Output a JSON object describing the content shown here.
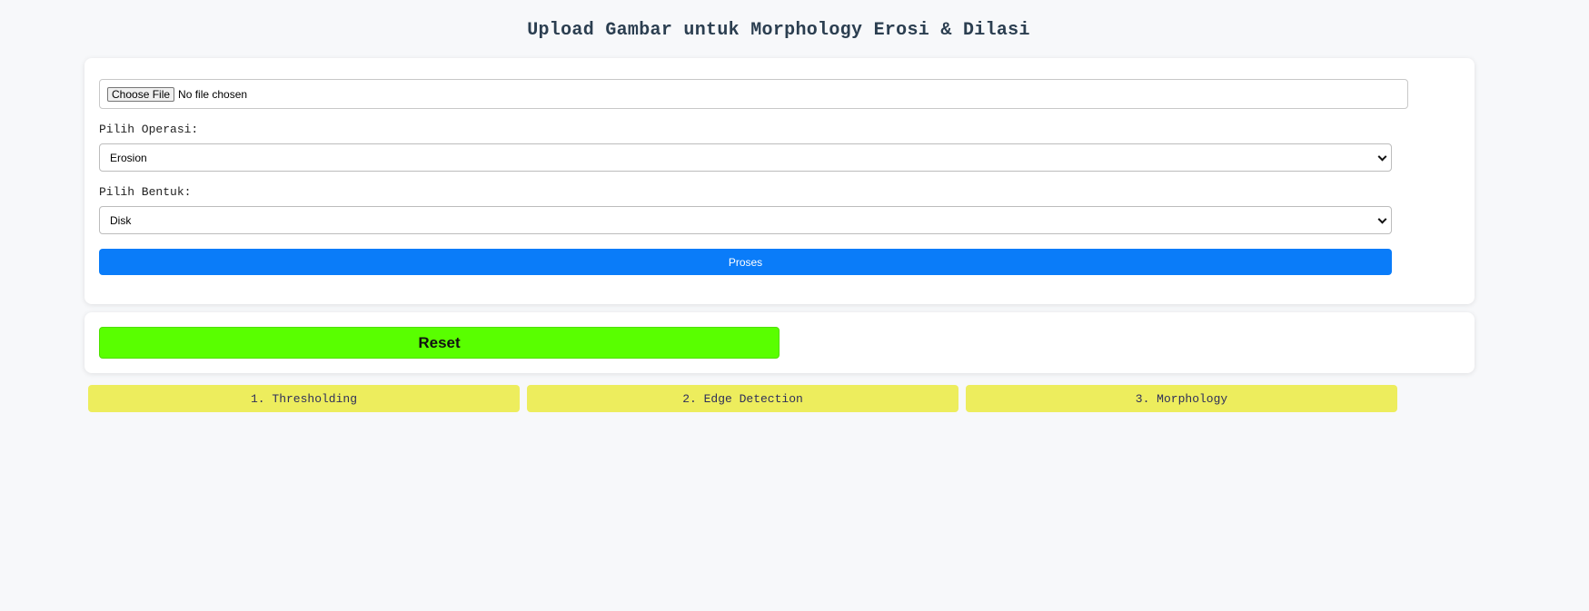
{
  "page": {
    "title": "Upload Gambar untuk Morphology Erosi & Dilasi"
  },
  "upload": {
    "choose_label": "Choose File",
    "status": "No file chosen"
  },
  "operation": {
    "label": "Pilih Operasi:",
    "selected": "Erosion"
  },
  "shape": {
    "label": "Pilih Bentuk:",
    "selected": "Disk"
  },
  "actions": {
    "process_label": "Proses",
    "reset_label": "Reset"
  },
  "nav": {
    "items": [
      {
        "label": "1. Thresholding"
      },
      {
        "label": "2. Edge Detection"
      },
      {
        "label": "3. Morphology"
      }
    ]
  },
  "colors": {
    "process_button": "#0a7cf9",
    "reset_button": "#59ff00",
    "nav_button": "#eded5d",
    "title_text": "#2b3e50"
  }
}
